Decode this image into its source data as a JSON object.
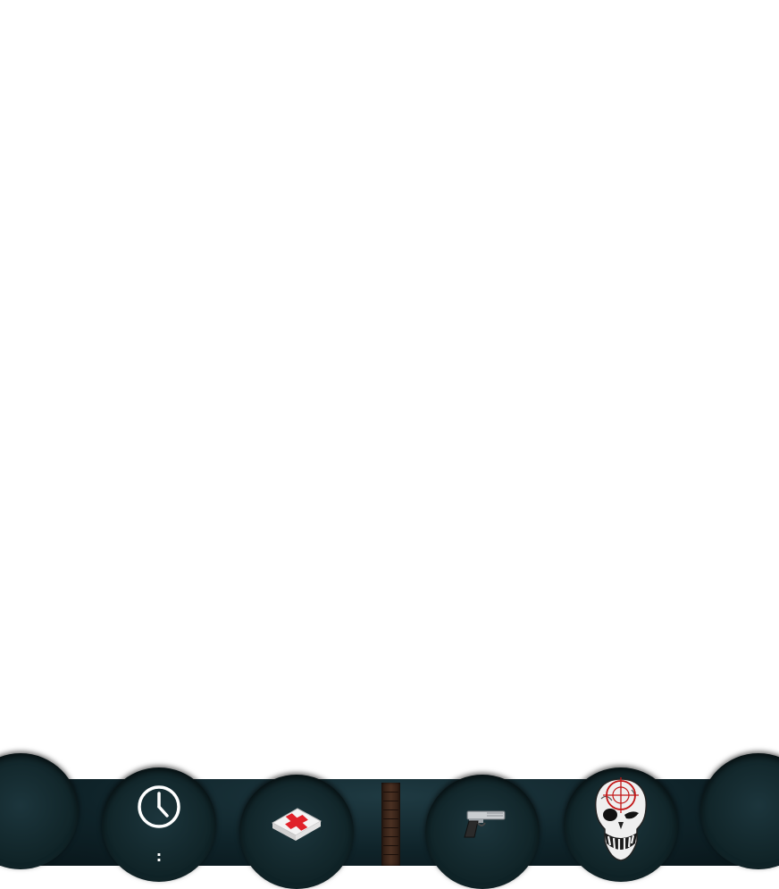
{
  "hud": {
    "time_icon": "clock-icon",
    "time_value": ":",
    "medkit_icon": "medkit-icon",
    "ammo_icon": "ammo-bar",
    "weapon_icon": "pistol-icon",
    "target_icon": "zombie-skull-crosshair-icon"
  },
  "colors": {
    "hud_background": "#0f2329",
    "crosshair": "#c21818",
    "medkit_cross": "#e0222a"
  }
}
